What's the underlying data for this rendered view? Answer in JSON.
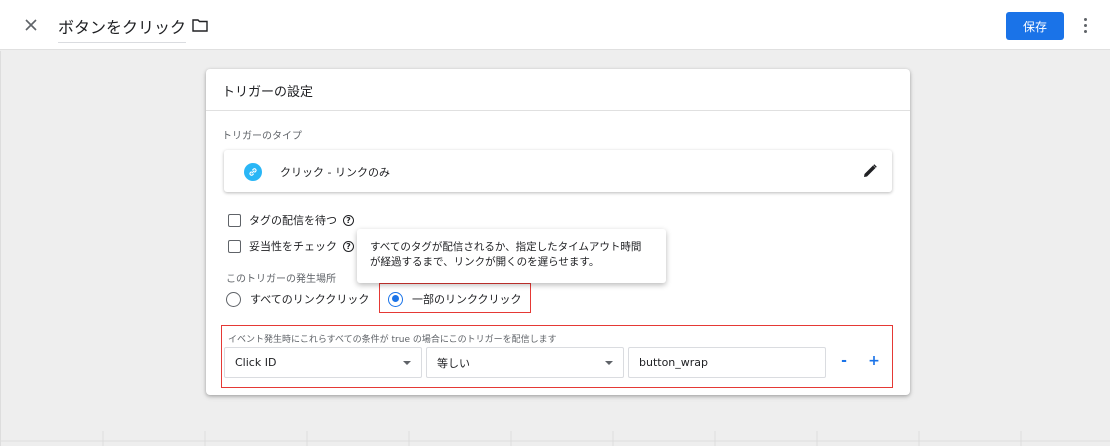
{
  "header": {
    "title": "ボタンをクリック",
    "save_label": "保存"
  },
  "card": {
    "title": "トリガーの設定",
    "trigger_type_label": "トリガーのタイプ",
    "trigger_type_value": "クリック - リンクのみ",
    "checkboxes": [
      {
        "label": "タグの配信を待つ",
        "checked": false
      },
      {
        "label": "妥当性をチェック",
        "checked": false
      }
    ],
    "tooltip_line1": "すべてのタグが配信されるか、指定したタイムアウト時間",
    "tooltip_line2": "が経過するまで、リンクが開くのを遅らせます。",
    "fire_on_label": "このトリガーの発生場所",
    "radios": [
      {
        "label": "すべてのリンククリック",
        "selected": false
      },
      {
        "label": "一部のリンククリック",
        "selected": true
      }
    ],
    "condition_label": "イベント発生時にこれらすべての条件が true の場合にこのトリガーを配信します",
    "condition": {
      "variable": "Click ID",
      "operator": "等しい",
      "value": "button_wrap",
      "minus_label": "-",
      "plus_label": "+"
    }
  },
  "colors": {
    "accent": "#1a73e8",
    "link_icon": "#29b6f6",
    "highlight": "#e53935"
  }
}
